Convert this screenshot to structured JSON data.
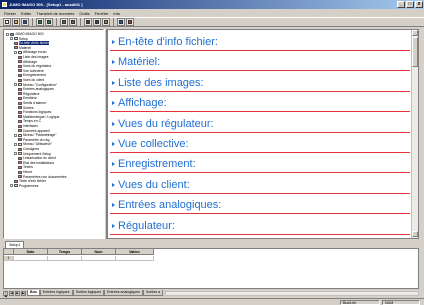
{
  "window": {
    "title": "JUMO IMAGO 500 - [Setup1 - ausditt1 ]",
    "min_symbol": "_",
    "max_symbol": "□",
    "close_symbol": "x"
  },
  "menu": [
    "Fichier",
    "Editer",
    "Transfert de données",
    "Outils",
    "Fenêtre",
    "Info"
  ],
  "toolbar": {
    "buttons": [
      {
        "icon": "new-file-icon",
        "color": "#ffffff"
      },
      {
        "icon": "open-folder-icon",
        "color": "#e0c050"
      },
      {
        "icon": "save-icon",
        "color": "#2050a0"
      },
      {
        "icon": "transfer-to-device-icon",
        "color": "#208040"
      },
      {
        "icon": "transfer-from-device-icon",
        "color": "#208040"
      },
      {
        "icon": "print-icon",
        "color": "#606060"
      },
      {
        "icon": "print-preview-icon",
        "color": "#606060"
      },
      {
        "icon": "cut-icon",
        "color": "#404040"
      },
      {
        "icon": "copy-icon",
        "color": "#404040"
      },
      {
        "icon": "paste-icon",
        "color": "#a08040"
      },
      {
        "icon": "help-icon",
        "color": "#2050c0"
      },
      {
        "icon": "setup-icon",
        "color": "#c03030"
      }
    ]
  },
  "tree": {
    "items": [
      {
        "label": "JUMO IMAGO 500",
        "level": 0,
        "kind": "root",
        "expanded": true
      },
      {
        "label": "Setup",
        "level": 1,
        "kind": "folder",
        "expanded": true
      },
      {
        "label": "En-tête d'info fichier",
        "level": 2,
        "kind": "leaf",
        "selected": true
      },
      {
        "label": "Matériel",
        "level": 2,
        "kind": "leaf"
      },
      {
        "label": "Affichage écran",
        "level": 2,
        "kind": "folder",
        "expanded": true
      },
      {
        "label": "Liste des images",
        "level": 3,
        "kind": "leaf"
      },
      {
        "label": "Affichage",
        "level": 3,
        "kind": "leaf"
      },
      {
        "label": "Vues du régulateur",
        "level": 3,
        "kind": "leaf"
      },
      {
        "label": "Vue collective",
        "level": 3,
        "kind": "leaf"
      },
      {
        "label": "Enregistrement",
        "level": 3,
        "kind": "leaf"
      },
      {
        "label": "Vues du client",
        "level": 3,
        "kind": "leaf"
      },
      {
        "label": "Niveau \"Configuration\"",
        "level": 2,
        "kind": "folder",
        "expanded": true
      },
      {
        "label": "Entrées analogiques",
        "level": 3,
        "kind": "leaf"
      },
      {
        "label": "Régulateur",
        "level": 3,
        "kind": "leaf"
      },
      {
        "label": "Emetteur",
        "level": 3,
        "kind": "leaf"
      },
      {
        "label": "Seuils d'alarme",
        "level": 3,
        "kind": "leaf"
      },
      {
        "label": "Sorties",
        "level": 3,
        "kind": "leaf"
      },
      {
        "label": "Fonctions logiques",
        "level": 3,
        "kind": "leaf"
      },
      {
        "label": "Mathématique / Logique",
        "level": 3,
        "kind": "leaf"
      },
      {
        "label": "Temps en C",
        "level": 3,
        "kind": "leaf"
      },
      {
        "label": "Interfaces",
        "level": 3,
        "kind": "leaf"
      },
      {
        "label": "Données appareil",
        "level": 3,
        "kind": "leaf"
      },
      {
        "label": "Niveau \"Paramétrage\"",
        "level": 2,
        "kind": "folder"
      },
      {
        "label": "Paramètre du rég.",
        "level": 3,
        "kind": "leaf"
      },
      {
        "label": "Niveau \"Utilisateur\"",
        "level": 2,
        "kind": "folder",
        "expanded": true
      },
      {
        "label": "Consignes",
        "level": 3,
        "kind": "leaf"
      },
      {
        "label": "Uniquement Setup",
        "level": 2,
        "kind": "folder",
        "expanded": true
      },
      {
        "label": "Linéarisation du client",
        "level": 3,
        "kind": "leaf"
      },
      {
        "label": "Etat des installations",
        "level": 3,
        "kind": "leaf"
      },
      {
        "label": "Textes",
        "level": 3,
        "kind": "leaf"
      },
      {
        "label": "Heure",
        "level": 3,
        "kind": "leaf"
      },
      {
        "label": "Paramètres non documentés",
        "level": 3,
        "kind": "leaf"
      },
      {
        "label": "Texte d'info fichier",
        "level": 2,
        "kind": "leaf"
      },
      {
        "label": "Programmes",
        "level": 1,
        "kind": "folder"
      }
    ]
  },
  "document": {
    "sections": [
      "En-tête d'info fichier:",
      "Matériel:",
      "Liste des images:",
      "Affichage:",
      "Vues du régulateur:",
      "Vue collective:",
      "Enregistrement:",
      "Vues du client:",
      "Entrées analogiques:",
      "Régulateur:"
    ],
    "label_color": "#1f6fd1",
    "line_color": "#e8323c"
  },
  "file_tabs": [
    "Setup1"
  ],
  "grid": {
    "columns": [
      "",
      "Date",
      "Temps",
      "Num",
      "Valeur"
    ],
    "rows": [
      [
        "1",
        "",
        "",
        "",
        ""
      ]
    ]
  },
  "sheet_tabs": {
    "nav": [
      "|◀",
      "◀",
      "▶",
      "▶|"
    ],
    "tabs": [
      "Bus",
      "Entrées logiques",
      "Sorties logiques",
      "Entrées analogiques",
      "Sorties a"
    ]
  },
  "status": {
    "text": "Bus/Lire",
    "code": "NUM"
  }
}
